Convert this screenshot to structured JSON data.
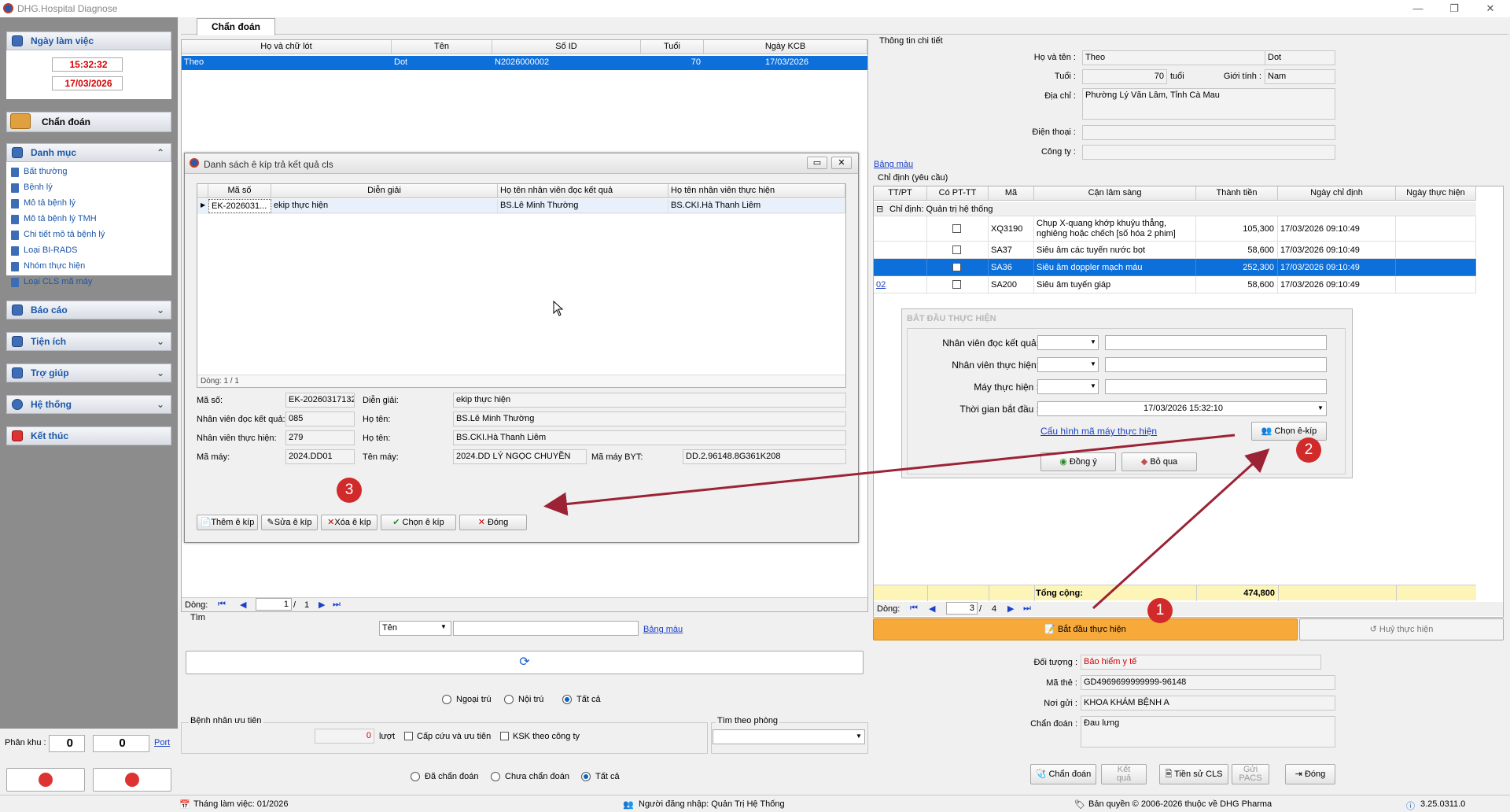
{
  "app": {
    "title": "DHG.Hospital Diagnose",
    "controls": {
      "min": "—",
      "max": "❐",
      "close": "✕"
    }
  },
  "sidebar": {
    "work_day": {
      "title": "Ngày làm việc",
      "time": "15:32:32",
      "date": "17/03/2026"
    },
    "active": "Chẩn đoán",
    "danhmuc": {
      "title": "Danh mục",
      "items": [
        "Bất thường",
        "Bệnh lý",
        "Mô tả bệnh lý",
        "Mô tả bệnh lý TMH",
        "Chi tiết mô tả bệnh lý",
        "Loại BI-RADS",
        "Nhóm thực hiện",
        "Loại CLS mã máy"
      ]
    },
    "sections": [
      "Báo cáo",
      "Tiện ích",
      "Trợ giúp",
      "Hệ thống"
    ],
    "exit": "Kết thúc",
    "phankhu": {
      "label": "Phân khu :",
      "v1": "0",
      "v2": "0",
      "port": "Port"
    }
  },
  "tab": "Chẩn đoán",
  "patients": {
    "headers": [
      "Họ và chữ lót",
      "Tên",
      "Số ID",
      "Tuổi",
      "Ngày KCB"
    ],
    "rows": [
      [
        "Theo",
        "Dot",
        "N2026000002",
        "70",
        "17/03/2026"
      ]
    ],
    "nav": {
      "label": "Dòng:",
      "page": "1",
      "sep": "/",
      "total": "1"
    }
  },
  "search": {
    "title": "Tìm",
    "field": "Tên",
    "link": "Bảng màu"
  },
  "filters": {
    "r1": [
      "Ngoại trú",
      "Nội trú",
      "Tất cả"
    ],
    "priority": {
      "title": "Bệnh nhân ưu tiên",
      "count": "0",
      "unit": "lượt",
      "c1": "Cấp cứu và ưu tiên",
      "c2": "KSK theo công ty"
    },
    "room": {
      "title": "Tìm theo phòng"
    },
    "r2": [
      "Đã chẩn đoán",
      "Chưa chẩn đoán",
      "Tất cả"
    ]
  },
  "ekip": {
    "title": "Danh sách ê kíp trả kết quả cls",
    "headers": [
      "Mã số",
      "Diễn giải",
      "Họ tên nhân viên đọc kết quả",
      "Họ tên nhân viên thực hiện"
    ],
    "row": [
      "EK-2026031...",
      "ekip thực hiện",
      "BS.Lê Minh Thường",
      "BS.CKI.Hà Thanh Liêm"
    ],
    "nav": {
      "text": "Dòng: 1 / 1",
      "icons": "⏮ ⏪ ◀  ▶ ⏩ ⏭ + − ▲ ✓ ✕"
    },
    "form": {
      "ma_so_l": "Mã số:",
      "ma_so": "EK-20260317132",
      "dien_giai_l": "Diễn giải:",
      "dien_giai": "ekip thực hiện",
      "nvdoc_l": "Nhân viên đọc kết quả:",
      "nvdoc": "085",
      "hoten1_l": "Họ tên:",
      "hoten1": "BS.Lê Minh Thường",
      "nvth_l": "Nhân viên thực hiện:",
      "nvth": "279",
      "hoten2_l": "Họ tên:",
      "hoten2": "BS.CKI.Hà Thanh Liêm",
      "mamay_l": "Mã máy:",
      "mamay": "2024.DD01",
      "tenmay_l": "Tên máy:",
      "tenmay": "2024.DD LÝ NGỌC CHUYỀN",
      "byt_l": "Mã máy BYT:",
      "byt": "DD.2.96148.8G361K208"
    },
    "buttons": [
      "Thêm ê kíp",
      "Sửa ê kíp",
      "Xóa  ê kíp",
      "Chọn  ê kíp",
      "Đóng"
    ]
  },
  "detail": {
    "title": "Thông tin chi tiết",
    "hoten_l": "Họ và tên :",
    "ho": "Theo",
    "ten": "Dot",
    "tuoi_l": "Tuổi :",
    "tuoi": "70",
    "tuoi_u": "tuổi",
    "gt_l": "Giới tính :",
    "gt": "Nam",
    "dc_l": "Địa chỉ :",
    "dc": "Phường Lý Văn Lâm, Tỉnh Cà Mau",
    "dt_l": "Điện thoại :",
    "ct_l": "Công ty :",
    "link": "Bảng màu"
  },
  "orders": {
    "title": "Chỉ định (yêu cầu)",
    "headers": [
      "TT/PT",
      "Có PT-TT",
      "Mã",
      "Cận lâm sàng",
      "Thành tiền",
      "Ngày chỉ định",
      "Ngày thực hiện"
    ],
    "group": "Chỉ định:  Quản trị hệ thống",
    "rows": [
      {
        "tt": "",
        "code": "XQ3190",
        "name": "Chụp X-quang khớp khuỷu thẳng, nghiêng hoặc chếch [số hóa 2 phim]",
        "price": "105,300",
        "date": "17/03/2026 09:10:49"
      },
      {
        "tt": "",
        "code": "SA37",
        "name": "Siêu âm các tuyến nước bọt",
        "price": "58,600",
        "date": "17/03/2026 09:10:49"
      },
      {
        "tt": "",
        "code": "SA36",
        "name": "Siêu âm doppler mạch máu",
        "price": "252,300",
        "date": "17/03/2026 09:10:49"
      },
      {
        "tt": "02",
        "code": "SA200",
        "name": "Siêu âm tuyến giáp",
        "price": "58,600",
        "date": "17/03/2026 09:10:49"
      }
    ],
    "total_l": "Tổng cộng:",
    "total": "474,800",
    "nav": {
      "label": "Dòng:",
      "page": "3",
      "sep": "/",
      "total": "4"
    }
  },
  "start": {
    "title": "BẮT ĐẦU THỰC HIỆN",
    "nvdoc": "Nhân viên đọc kết quả:",
    "nvth": "Nhân viên thực hiện:",
    "may": "Máy thực hiện :",
    "time_l": "Thời gian bắt đầu :",
    "time": "17/03/2026 15:32:10",
    "cfg": "Cấu hình mã máy thực hiện",
    "chon": "Chọn ê-kíp",
    "ok": "Đồng ý",
    "skip": "Bỏ qua"
  },
  "actions": {
    "start": "Bắt đầu thực hiện",
    "cancel": "Huỷ thực hiện"
  },
  "insurance": {
    "dt_l": "Đối tượng :",
    "dt": "Bảo hiểm y tế",
    "mt_l": "Mã thẻ :",
    "mt": "GD4969699999999-96148",
    "ng_l": "Nơi gửi :",
    "ng": "KHOA KHÁM BỆNH A",
    "cd_l": "Chẩn đoán :",
    "cd": "Đau lưng"
  },
  "bottom": {
    "cd": "Chẩn đoán",
    "kq1": "Kết",
    "kq2": "quả",
    "ls": "Tiền sử CLS",
    "pacs1": "Gửi",
    "pacs2": "PACS",
    "close": "Đóng"
  },
  "status": {
    "month": "Tháng làm việc: 01/2026",
    "user": "Người đăng nhập: Quản Trị Hệ Thống",
    "copy": "Bản quyền © 2006-2026 thuộc về DHG Pharma",
    "ver": "3.25.0311.0"
  },
  "steps": [
    "1",
    "2",
    "3"
  ],
  "colors": {
    "accent": "#0d6fd9",
    "orange": "#f7a93a",
    "arrow": "#9b2335",
    "red": "#d12a2a"
  }
}
